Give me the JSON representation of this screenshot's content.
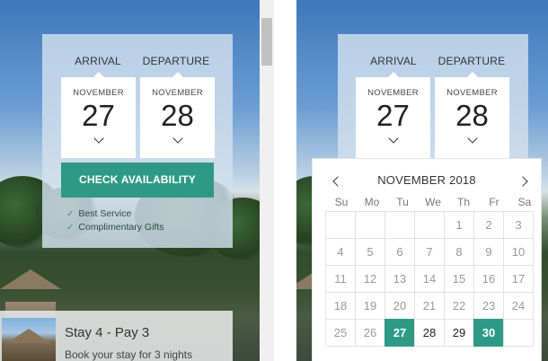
{
  "left": {
    "booking": {
      "arrival_label": "ARRIVAL",
      "departure_label": "DEPARTURE",
      "arrival": {
        "month": "NOVEMBER",
        "day": "27"
      },
      "departure": {
        "month": "NOVEMBER",
        "day": "28"
      },
      "check_label": "CHECK AVAILABILITY",
      "perks": [
        "Best Service",
        "Complimentary Gifts"
      ]
    },
    "promo": {
      "title": "Stay 4 - Pay 3",
      "subtitle": "Book your stay for 3 nights"
    }
  },
  "right": {
    "booking": {
      "arrival_label": "ARRIVAL",
      "departure_label": "DEPARTURE",
      "arrival": {
        "month": "NOVEMBER",
        "day": "27"
      },
      "departure": {
        "month": "NOVEMBER",
        "day": "28"
      }
    },
    "calendar": {
      "title": "NOVEMBER 2018",
      "weekdays": [
        "Su",
        "Mo",
        "Tu",
        "We",
        "Th",
        "Fr",
        "Sa"
      ],
      "weeks": [
        [
          "",
          "",
          "",
          "",
          "1",
          "2",
          "3"
        ],
        [
          "4",
          "5",
          "6",
          "7",
          "8",
          "9",
          "10"
        ],
        [
          "11",
          "12",
          "13",
          "14",
          "15",
          "16",
          "17"
        ],
        [
          "18",
          "19",
          "20",
          "21",
          "22",
          "23",
          "24"
        ],
        [
          "25",
          "26",
          "27",
          "28",
          "29",
          "30",
          ""
        ]
      ],
      "selected": [
        "27",
        "30"
      ],
      "available_from": 27
    }
  },
  "colors": {
    "accent": "#2e9a86",
    "panel": "#d2e1ee"
  },
  "icons": {
    "chevron": "chevron-down-icon",
    "prev": "chevron-left-icon",
    "next": "chevron-right-icon",
    "check": "check-icon"
  }
}
